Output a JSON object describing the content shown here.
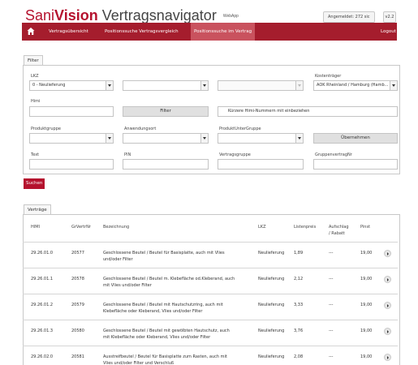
{
  "header": {
    "brand_sani": "Sani",
    "brand_vision": "Vision",
    "brand_app": "Vertragsnavigator",
    "webapp": "WebApp",
    "user": "Angemeldet: 272 sic",
    "version": "v2.2"
  },
  "nav": {
    "items": [
      "Vertragsübersicht",
      "Positionssuche Vertragsvergleich",
      "Positionssuche im Vertrag"
    ],
    "logout": "Logout",
    "active_index": 2
  },
  "filter": {
    "tab": "Filter",
    "lkz_label": "LKZ",
    "lkz_value": "0 - Neulieferung",
    "kostentraeger_label": "Kostenträger",
    "kostentraeger_value": "AOK Rheinland / Hamburg (Hamb...",
    "himi_label": "Himi",
    "himi_value": "",
    "filter_button": "Filter",
    "checkbox_label": "Kürzere Himi-Nummern mit einbeziehen",
    "produktgruppe_label": "Produktgruppe",
    "anwendungsort_label": "Anwendungsort",
    "produktuntergruppe_label": "ProduktUnterGruppe",
    "uebernehmen_button": "Übernehmen",
    "text_label": "Text",
    "pin_label": "PIN",
    "vertragsgruppe_label": "Vertragsgruppe",
    "gruppenvertragnr_label": "GruppenvertragNr",
    "search_button": "Suchen"
  },
  "contracts": {
    "tab": "Verträge",
    "headers": {
      "himi": "HIMI",
      "grvertrnr": "GrVertrNr",
      "bezeichnung": "Bezeichnung",
      "lkz": "LKZ",
      "listenpreis": "Listenpreis",
      "aufschlag_1": "Aufschlag",
      "aufschlag_2": "/ Rabatt",
      "pinst": "Pinst"
    },
    "rows": [
      {
        "himi": "29.26.01.0",
        "gr": "20577",
        "bez1": "Geschlossene Beutel / Beutel für Basisplatte, auch mit Vlies",
        "bez2": "und/oder Filter",
        "lkz": "Neulieferung",
        "preis": "1,89",
        "auf": "---",
        "pinst": "19,00"
      },
      {
        "himi": "29.26.01.1",
        "gr": "20578",
        "bez1": "Geschlossene Beutel / Beutel m. Klebefläche od.Kleberand, auch",
        "bez2": "mit Vlies und/oder Filter",
        "lkz": "Neulieferung",
        "preis": "2,12",
        "auf": "---",
        "pinst": "19,00"
      },
      {
        "himi": "29.26.01.2",
        "gr": "20579",
        "bez1": "Geschlossene Beutel / Beutel mit Hautschutzring, auch mit",
        "bez2": "Klebefläche oder Kleberand, Vlies und/oder Filter",
        "lkz": "Neulieferung",
        "preis": "3,33",
        "auf": "---",
        "pinst": "19,00"
      },
      {
        "himi": "29.26.01.3",
        "gr": "20580",
        "bez1": "Geschlossene Beutel / Beutel mit gewölbten Hautschutz, auch",
        "bez2": "mit Klebefläche oder Kleberand, Vlies und/oder Filter",
        "lkz": "Neulieferung",
        "preis": "3,76",
        "auf": "---",
        "pinst": "19,00"
      },
      {
        "himi": "29.26.02.0",
        "gr": "20581",
        "bez1": "Ausstreifbeutel / Beutel für Basisplatte zum Rasten, auch mit",
        "bez2": "Vlies und/oder Filter und Verschluß",
        "lkz": "Neulieferung",
        "preis": "2,08",
        "auf": "---",
        "pinst": "19,00"
      }
    ]
  },
  "colors": {
    "brand_red": "#b5122e",
    "nav_bg": "#a51d2d",
    "nav_active": "#c9525e"
  }
}
